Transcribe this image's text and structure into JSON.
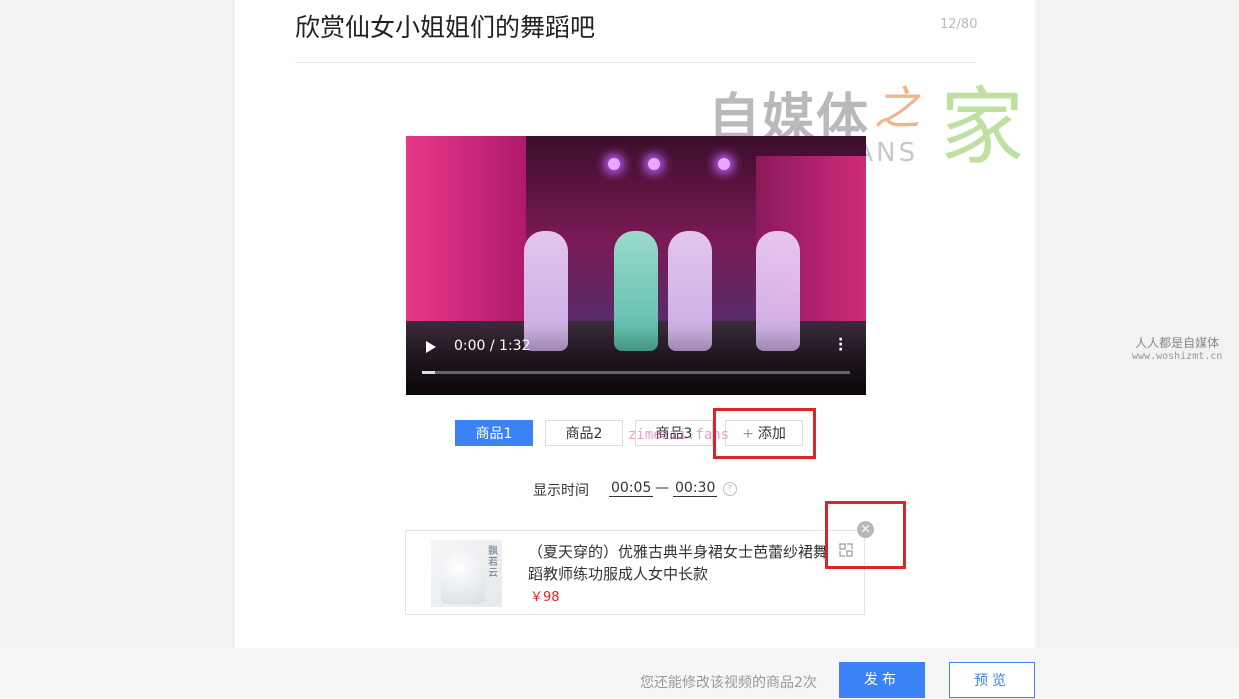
{
  "editor": {
    "title": "欣赏仙女小姐姐们的舞蹈吧",
    "char_count": "12/80"
  },
  "watermark": {
    "brand": "自媒体",
    "mid": "之",
    "end": "家",
    "latin": "ZIMEITI FANS",
    "overlay": "zimeiti.fans"
  },
  "video": {
    "time": "0:00 / 1:32",
    "progress_fraction": 0.03
  },
  "product_tabs": {
    "items": [
      "商品1",
      "商品2",
      "商品3"
    ],
    "add_label": "添加",
    "active_index": 0
  },
  "display_time": {
    "label": "显示时间",
    "start": "00:05",
    "separator": "—",
    "end": "00:30"
  },
  "product": {
    "name": "（夏天穿的）优雅古典半身裙女士芭蕾纱裙舞蹈教师练功服成人女中长款",
    "price": "￥98",
    "image_text": "飘若云"
  },
  "side_watermark": {
    "line1": "人人都是自媒体",
    "line2": "www.woshizmt.cn"
  },
  "footer": {
    "hint": "您还能修改该视频的商品2次",
    "publish_label": "发布",
    "preview_label": "预览"
  }
}
